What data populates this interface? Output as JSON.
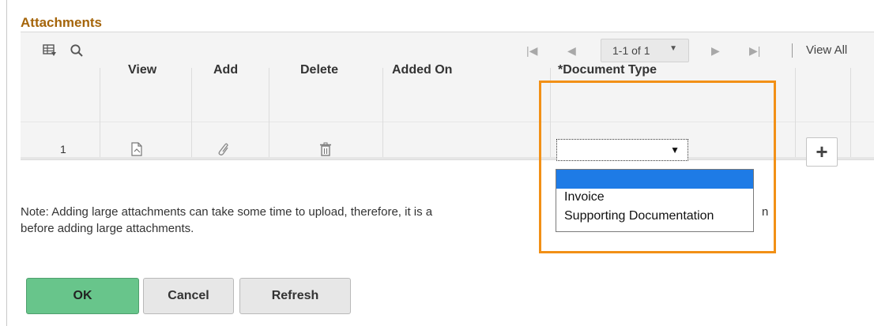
{
  "section": {
    "title": "Attachments"
  },
  "toolbar": {
    "customize_icon": "grid-customize-icon",
    "search_icon": "search-icon",
    "pager": "1-1 of 1",
    "view_all": "View All"
  },
  "grid": {
    "headers": [
      "View",
      "Add",
      "Delete",
      "Added On",
      "*Document Type"
    ],
    "rows": [
      {
        "num": "1",
        "view_icon": "view-attachment-icon",
        "add_icon": "paperclip-icon",
        "delete_icon": "trash-icon",
        "added_on": "",
        "document_type": ""
      }
    ],
    "add_row_label": "+"
  },
  "dropdown": {
    "options": [
      "",
      "Invoice",
      "Supporting Documentation"
    ]
  },
  "note": {
    "line1": "Note: Adding large attachments can take some time to upload, therefore, it is a",
    "line1_end": "n",
    "line2": "before adding large attachments."
  },
  "buttons": {
    "ok": "OK",
    "cancel": "Cancel",
    "refresh": "Refresh"
  },
  "colors": {
    "title": "#a5650a",
    "highlight": "#f29016",
    "ok_button": "#68c58b",
    "selected_option": "#1e7be6"
  }
}
